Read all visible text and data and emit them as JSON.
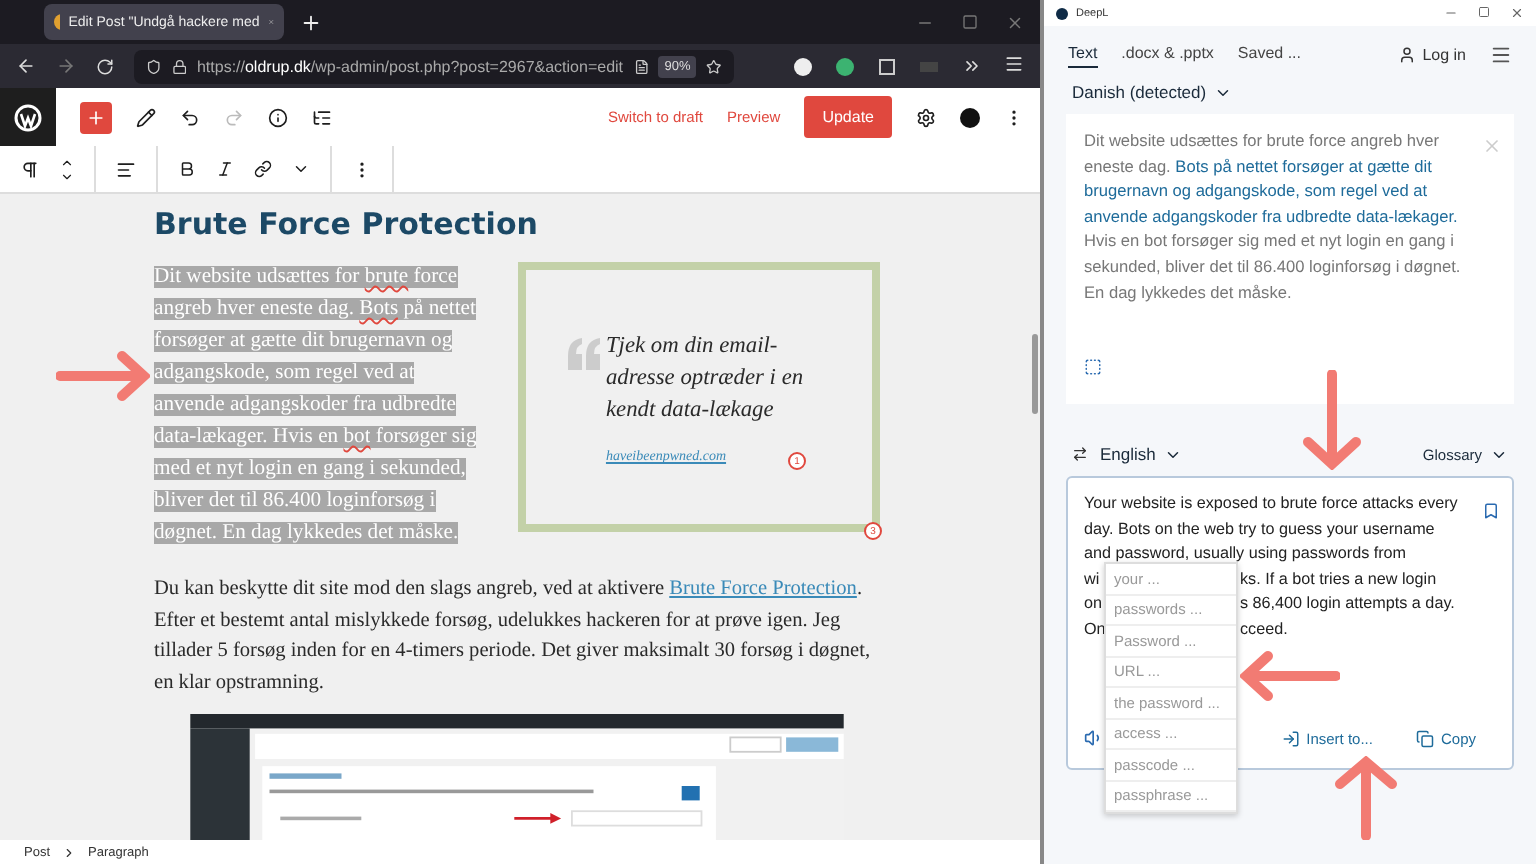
{
  "browser": {
    "tab": {
      "title": "Edit Post \"Undgå hackere med"
    },
    "address": {
      "url": "https://**oldrup.dk**/wp-admin/post.php?post=2967&action=edit",
      "zoom": "90%"
    }
  },
  "editor": {
    "actions": [
      "Switch to draft",
      "Preview"
    ],
    "primary": "Update",
    "heading": "Brute Force Protection",
    "selected_paragraph": {
      "selected": true,
      "segments": [
        {
          "text": "Dit website udsættes for ",
          "misspelled": false
        },
        {
          "text": "brute",
          "misspelled": true
        },
        {
          "text": " force angreb hver eneste dag. ",
          "misspelled": false
        },
        {
          "text": "Bots",
          "misspelled": true
        },
        {
          "text": " på nettet forsøger at gætte dit brugernavn og adgangskode, som regel ved at anvende adgangskoder fra udbredte data-lækager. Hvis en ",
          "misspelled": false
        },
        {
          "text": "bot",
          "misspelled": true
        },
        {
          "text": " forsøger sig med et nyt login en gang i sekunded, bliver det til 86.400 loginforsøg i døgnet. En dag lykkedes det måske.",
          "misspelled": false
        }
      ]
    },
    "quote": {
      "text": "Tjek om din email-adresse optræder i en kendt data-lækage",
      "link": "haveibeenpwned.com",
      "markers": [
        "1",
        "3"
      ]
    },
    "paragraph": {
      "before": "Du kan beskytte dit site mod den slags angreb, ved at aktivere ",
      "link": "Brute Force Protection",
      "after": ". Efter et bestemt antal mislykkede forsøg, udelukkes hackeren for at prøve igen. Jeg tillader 5 forsøg inden for en 4-timers periode. Det giver maksimalt 30 forsøg i døgnet, en klar opstramning."
    },
    "image": {
      "kind": "picture"
    },
    "breadcrumb": [
      "Post",
      "Paragraph"
    ]
  },
  "translator": {
    "app_title": "DeepL",
    "tabs": [
      {
        "label": "Text",
        "selected": true
      },
      {
        "label": ".docx & .pptx",
        "selected": false
      },
      {
        "label": "Saved ...",
        "selected": false
      }
    ],
    "login": "Log in",
    "source": {
      "language": "Danish (detected)",
      "segments": [
        {
          "text": "Dit website udsættes for brute force angreb hver eneste dag. ",
          "highlighted": false
        },
        {
          "text": "Bots på nettet forsøger at gætte dit brugernavn og adgangskode, som regel ved at anvende adgangskoder fra udbredte data-lækager.",
          "highlighted": true
        },
        {
          "text": " Hvis en bot forsøger sig med et nyt login en gang i sekunded, bliver det til 86.400 loginforsøg i døgnet. En dag lykkedes det måske.",
          "highlighted": false
        }
      ]
    },
    "target": {
      "language": "English",
      "glossary": "Glossary",
      "lines": [
        {
          "start": "Your website is exposed to brute force attacks every"
        },
        {
          "start": "day. Bots on the web try to guess your username"
        },
        {
          "start": "and password, usually using passwords from"
        },
        {
          "start": "wi",
          "end": "ks. If a bot tries a new login"
        },
        {
          "start": "on",
          "end": "s 86,400 login attempts a day."
        },
        {
          "start": "On",
          "end": "cceed."
        }
      ],
      "suggestions": [
        "your ...",
        "passwords ...",
        "Password ...",
        "URL ...",
        "the password ...",
        "access ...",
        "passcode ...",
        "passphrase ..."
      ],
      "actions": [
        "Insert to...",
        "Copy"
      ]
    }
  }
}
